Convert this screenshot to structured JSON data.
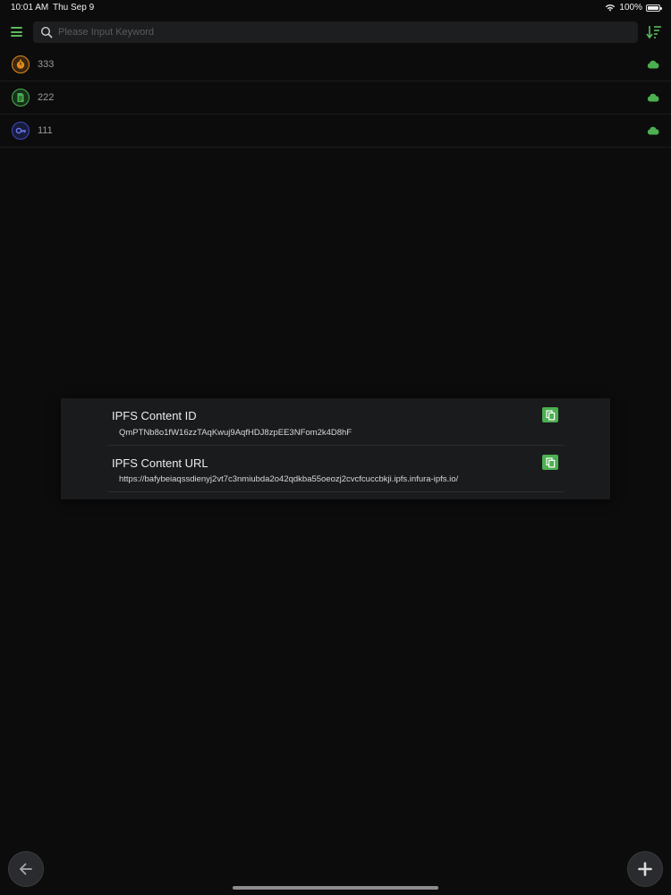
{
  "status_bar": {
    "time": "10:01 AM",
    "date": "Thu Sep 9",
    "battery": "100%"
  },
  "search": {
    "placeholder": "Please Input Keyword",
    "value": ""
  },
  "items": [
    {
      "label": "333",
      "icon": "timer-icon",
      "color": "#e08a1e"
    },
    {
      "label": "222",
      "icon": "document-icon",
      "color": "#4caf50"
    },
    {
      "label": "111",
      "icon": "key-icon",
      "color": "#3e4ac0"
    }
  ],
  "dialog": {
    "content_id_title": "IPFS Content ID",
    "content_id_value": "QmPTNb8o1fW16zzTAqKwuj9AqfHDJ8zpEE3NFom2k4D8hF",
    "content_url_title": "IPFS Content URL",
    "content_url_value": "https://bafybeiaqssdienyj2vt7c3nmiubda2o42qdkba55oeozj2cvcfcuccbkji.ipfs.infura-ipfs.io/"
  },
  "colors": {
    "accent": "#4caf50",
    "background": "#0c0c0d",
    "dialog": "#1a1b1d"
  }
}
